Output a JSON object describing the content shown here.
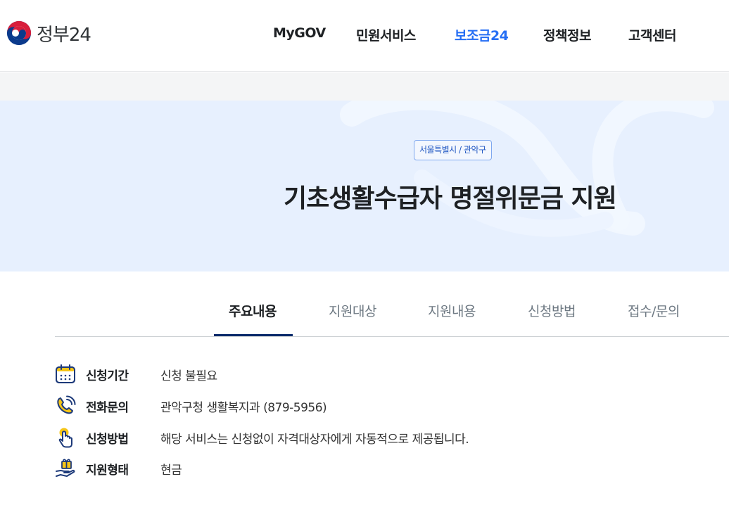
{
  "header": {
    "logo_text": "정부24",
    "logo_icon": "taegeuk-emblem-icon",
    "nav": [
      {
        "label": "MyGOV",
        "active": false
      },
      {
        "label": "민원서비스",
        "active": false
      },
      {
        "label": "보조금24",
        "active": true
      },
      {
        "label": "정책정보",
        "active": false
      },
      {
        "label": "고객센터",
        "active": false
      }
    ]
  },
  "hero": {
    "region": "서울특별시 / 관악구",
    "title": "기초생활수급자 명절위문금 지원"
  },
  "tabs": [
    {
      "label": "주요내용",
      "active": true
    },
    {
      "label": "지원대상",
      "active": false
    },
    {
      "label": "지원내용",
      "active": false
    },
    {
      "label": "신청방법",
      "active": false
    },
    {
      "label": "접수/문의",
      "active": false
    }
  ],
  "info": [
    {
      "icon": "calendar-icon",
      "label": "신청기간",
      "value": "신청 불필요"
    },
    {
      "icon": "phone-icon",
      "label": "전화문의",
      "value": "관악구청 생활복지과 (879-5956)"
    },
    {
      "icon": "hand-pointer-icon",
      "label": "신청방법",
      "value": "해당 서비스는 신청없이 자격대상자에게 자동적으로 제공됩니다."
    },
    {
      "icon": "hand-gift-icon",
      "label": "지원형태",
      "value": "현금"
    }
  ],
  "colors": {
    "accent": "#256ef4",
    "hero_bg": "#e7f0fe",
    "tab_underline": "#0b2b6b",
    "icon_navy": "#1d3a7a",
    "icon_yellow": "#f5c518"
  }
}
